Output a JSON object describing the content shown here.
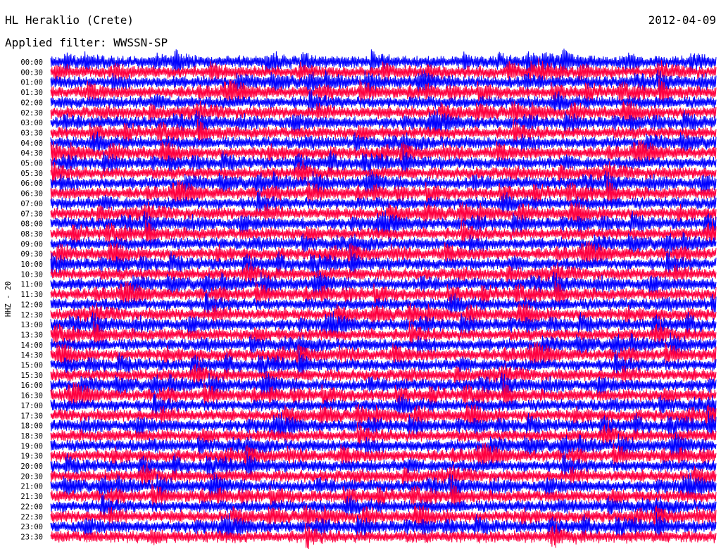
{
  "header": {
    "station": "HL Heraklio (Crete)",
    "date": "2012-04-09",
    "filter_line": "Applied filter: WWSSN-SP"
  },
  "chart_data": {
    "type": "line",
    "channel_label": "HHZ - 20",
    "trace_colors": [
      "#0000ff",
      "#ff0040"
    ],
    "row_labels": [
      "00:00",
      "00:30",
      "01:00",
      "01:30",
      "02:00",
      "02:30",
      "03:00",
      "03:30",
      "04:00",
      "04:30",
      "05:00",
      "05:30",
      "06:00",
      "06:30",
      "07:00",
      "07:30",
      "08:00",
      "08:30",
      "09:00",
      "09:30",
      "10:00",
      "10:30",
      "11:00",
      "11:30",
      "12:00",
      "12:30",
      "13:00",
      "13:30",
      "14:00",
      "14:30",
      "15:00",
      "15:30",
      "16:00",
      "16:30",
      "17:00",
      "17:30",
      "18:00",
      "18:30",
      "19:00",
      "19:30",
      "20:00",
      "20:30",
      "21:00",
      "21:30",
      "22:00",
      "22:30",
      "23:00",
      "23:30"
    ],
    "background": "#ffffff"
  }
}
